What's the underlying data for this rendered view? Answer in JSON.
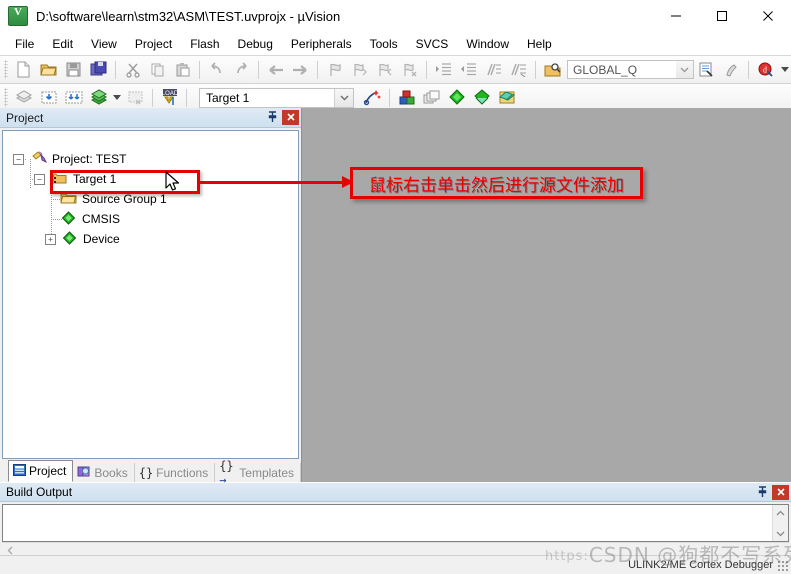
{
  "window": {
    "title": "D:\\software\\learn\\stm32\\ASM\\TEST.uvprojx - µVision",
    "app_icon": "keil-uvision-logo",
    "minimize": "—",
    "maximize": "□",
    "close": "✕"
  },
  "menu": {
    "items": [
      {
        "label": "File"
      },
      {
        "label": "Edit"
      },
      {
        "label": "View"
      },
      {
        "label": "Project"
      },
      {
        "label": "Flash"
      },
      {
        "label": "Debug"
      },
      {
        "label": "Peripherals"
      },
      {
        "label": "Tools"
      },
      {
        "label": "SVCS"
      },
      {
        "label": "Window"
      },
      {
        "label": "Help"
      }
    ]
  },
  "toolbar_file": {
    "icons": [
      "new-file-icon",
      "open-file-icon",
      "save-icon",
      "save-all-icon",
      "cut-icon",
      "copy-icon",
      "paste-icon",
      "undo-icon",
      "redo-icon",
      "navigate-back-icon",
      "navigate-forward-icon",
      "bookmark-toggle-icon",
      "bookmark-prev-icon",
      "bookmark-next-icon",
      "bookmark-clear-icon",
      "indent-icon",
      "outdent-icon",
      "comment-icon",
      "uncomment-icon",
      "find-in-files-icon"
    ],
    "global_combo_value": "GLOBAL_Q",
    "global_combo_placeholder": "GLOBAL_Q",
    "after_icons": [
      "browse-info-icon",
      "find-references-icon",
      "debug-start-icon"
    ]
  },
  "toolbar_build": {
    "icons": [
      "translate-file-icon",
      "build-target-icon",
      "rebuild-all-icon",
      "batch-build-icon",
      "stop-build-icon",
      "download-icon"
    ],
    "target_value": "Target 1",
    "target_placeholder": "Target 1",
    "right_icons": [
      "options-target-icon",
      "manage-project-items-icon",
      "multi-project-icon",
      "pack-installer-icon",
      "manage-rte-icon",
      "svcs-icon"
    ]
  },
  "project_panel": {
    "title": "Project",
    "pin_icon": "pin-icon",
    "close_icon": "close-icon",
    "tree": [
      {
        "label": "Project: TEST",
        "icon": "project-icon",
        "depth": 0,
        "expander": "-"
      },
      {
        "label": "Target 1",
        "icon": "target-icon",
        "depth": 1,
        "expander": "-"
      },
      {
        "label": "Source Group 1",
        "icon": "folder-icon",
        "depth": 2,
        "expander": ""
      },
      {
        "label": "CMSIS",
        "icon": "component-icon",
        "depth": 2,
        "expander": ""
      },
      {
        "label": "Device",
        "icon": "component-icon",
        "depth": 2,
        "expander": "+"
      }
    ],
    "tabs": [
      {
        "label": "Project",
        "icon": "project-tab-icon",
        "active": true
      },
      {
        "label": "Books",
        "icon": "books-tab-icon",
        "active": false
      },
      {
        "label": "Functions",
        "icon": "functions-tab-icon",
        "active": false
      },
      {
        "label": "Templates",
        "icon": "templates-tab-icon",
        "active": false
      }
    ]
  },
  "annotation": {
    "text": "鼠标右击单击然后进行源文件添加",
    "color": "#e60000",
    "arrow_icon": "arrow-right-icon",
    "cursor_icon": "mouse-pointer-icon"
  },
  "build_output": {
    "title": "Build Output",
    "pin_icon": "pin-icon",
    "close_icon": "close-icon",
    "content": "",
    "scroll_up_icon": "chevron-up-icon",
    "scroll_down_icon": "chevron-down-icon",
    "scroll_left_icon": "chevron-left-icon"
  },
  "statusbar": {
    "left_text": "",
    "debugger": "ULINK2/ME Cortex Debugger",
    "resize_grip": "resize-grip-icon"
  },
  "watermark": {
    "url": "https:",
    "text": "CSDN @狗都不写系列"
  }
}
